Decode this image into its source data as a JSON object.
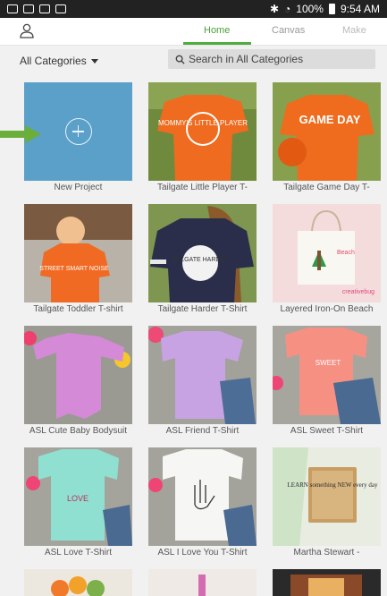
{
  "status": {
    "battery": "100%",
    "time": "9:54 AM"
  },
  "nav": {
    "tabs": [
      "Home",
      "Canvas",
      "Make"
    ]
  },
  "filter": {
    "category": "All Categories",
    "search_placeholder": "Search in All Categories"
  },
  "projects": [
    {
      "label": "New Project"
    },
    {
      "label": "Tailgate Little Player T-"
    },
    {
      "label": "Tailgate Game Day T-"
    },
    {
      "label": "Tailgate Toddler T-shirt"
    },
    {
      "label": "Tailgate Harder T-Shirt"
    },
    {
      "label": "Layered Iron-On Beach"
    },
    {
      "label": "ASL Cute Baby Bodysuit"
    },
    {
      "label": "ASL Friend T-Shirt"
    },
    {
      "label": "ASL Sweet T-Shirt"
    },
    {
      "label": "ASL Love T-Shirt"
    },
    {
      "label": "ASL I Love You T-Shirt"
    },
    {
      "label": "Martha Stewart -"
    }
  ],
  "thumb_text": {
    "t1": "MOMMY'S LITTLE PLAYER",
    "t2": "GAME DAY",
    "t3": "STREET SMART NOISE",
    "t4": "TAILGATE HARDER",
    "t5_logo": "creativebug",
    "t6": "LOVE",
    "t7": "SWEET",
    "t8": "LEARN something NEW every day"
  },
  "colors": {
    "accent": "#4cae3c",
    "new_project": "#5aa0c9",
    "arrow": "#6cae3a"
  }
}
